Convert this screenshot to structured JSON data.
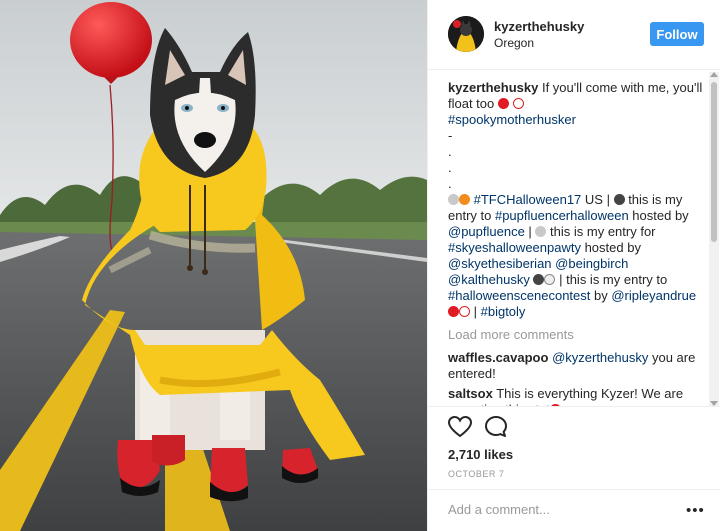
{
  "post": {
    "username": "kyzerthehusky",
    "location": "Oregon",
    "follow_label": "Follow",
    "likes": "2,710 likes",
    "date": "OCTOBER 7",
    "add_comment_placeholder": "Add a comment...",
    "more_label": "•••"
  },
  "caption": {
    "username": "kyzerthehusky",
    "line1": "If you'll come with me, you'll float too",
    "hashtag1": "#spookymotherhusker",
    "dots": [
      "-",
      ".",
      ".",
      "."
    ],
    "seg1": "#TFCHalloween17",
    "seg2": " US | ",
    "seg3": " this is my entry to ",
    "seg4": "#pupfluencerhalloween",
    "seg5": " hosted by ",
    "seg6": "@pupfluence",
    "seg7": " | ",
    "seg8": " this is my entry for ",
    "seg9": "#skyeshalloweenpawty",
    "seg10": " hosted by ",
    "seg11": "@skyethesiberian",
    "seg12": " ",
    "seg13": "@beingbirch",
    "seg14": " ",
    "seg15": "@kalthehusky",
    "seg16": " | this is my entry to ",
    "seg17": "#halloweenscenecontest",
    "seg18": " by ",
    "seg19": "@ripleyandrue",
    "seg20": " | ",
    "seg21": "#bigtoly"
  },
  "load_more": "Load more comments",
  "comments": [
    {
      "user": "waffles.cavapoo",
      "mention": "@kyzerthehusky",
      "text": " you are entered!"
    },
    {
      "user": "saltsox",
      "mention": "",
      "text": " This is everything Kyzer! We are reposting this stat"
    }
  ],
  "colors": {
    "follow": "#3897f0",
    "link": "#003569",
    "muted": "#999999",
    "raincoat": "#f7c81e",
    "balloon": "#e01b24"
  },
  "icons": [
    "heart-icon",
    "comment-icon",
    "more-options-icon"
  ]
}
